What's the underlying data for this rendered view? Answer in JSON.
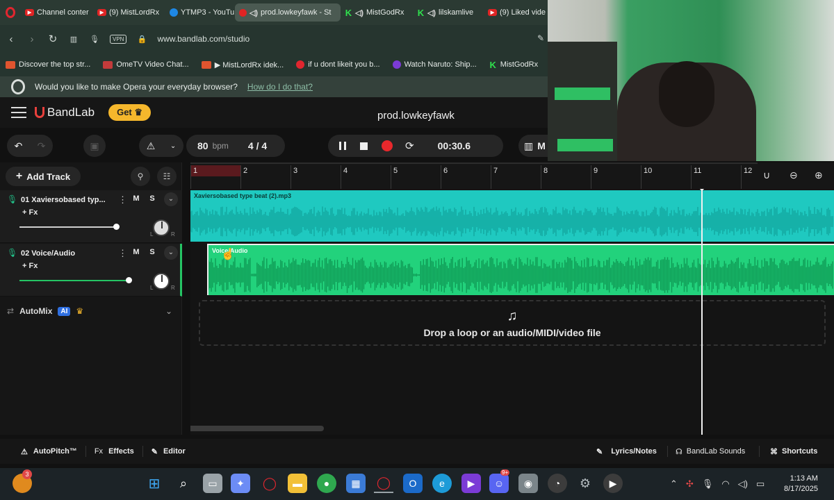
{
  "browser": {
    "tabs": [
      {
        "label": "Channel conter",
        "icon": "youtube-icon",
        "active": false
      },
      {
        "label": "(9) MistLordRx",
        "icon": "youtube-icon",
        "active": false
      },
      {
        "label": "YTMP3 - YouTu",
        "icon": "ytmp3-icon",
        "active": false
      },
      {
        "label": "prod.lowkeyfawk - St",
        "icon": "bandlab-icon",
        "active": true
      },
      {
        "label": "MistGodRx",
        "icon": "kick-icon",
        "active": false
      },
      {
        "label": "lilskamlive",
        "icon": "kick-icon",
        "active": false
      },
      {
        "label": "(9) Liked vide",
        "icon": "youtube-icon",
        "active": false
      }
    ],
    "vpn_label": "VPN",
    "url": "www.bandlab.com/studio",
    "bookmarks": [
      {
        "label": "Discover the top str...",
        "color": "#e0542f"
      },
      {
        "label": "OmeTV Video Chat...",
        "color": "#c23b3b"
      },
      {
        "label": "▶ MistLordRx idek...",
        "color": "#e0542f"
      },
      {
        "label": "if u dont likeit you b...",
        "color": "#e0262f"
      },
      {
        "label": "Watch Naruto: Ship...",
        "color": "#7b3bd6"
      },
      {
        "label": "MistGodRx",
        "color": "#2fe14d"
      }
    ],
    "opera_prompt": "Would you like to make Opera your everyday browser?",
    "opera_link": "How do I do that?"
  },
  "bandlab": {
    "logo": "BandLab",
    "get_label": "Get",
    "project_title": "prod.lowkeyfawk",
    "tempo": "80",
    "tempo_unit": "bpm",
    "time_signature": "4 / 4",
    "time_display": "00:30.6",
    "add_track_label": "Add Track",
    "tracks": [
      {
        "name": "01  Xaviersobased typ...",
        "fx": "+ Fx",
        "mute": "M",
        "solo": "S",
        "pan_l": "L",
        "pan_r": "R"
      },
      {
        "name": "02  Voice/Audio",
        "fx": "+ Fx",
        "mute": "M",
        "solo": "S",
        "pan_l": "L",
        "pan_r": "R"
      }
    ],
    "track_volumes": [
      0.71,
      0.8
    ],
    "automix_label": "AutoMix",
    "automix_badge": "AI",
    "ruler_bars": [
      "1",
      "2",
      "3",
      "4",
      "5",
      "6",
      "7",
      "8",
      "9",
      "10",
      "11",
      "12"
    ],
    "clips": [
      {
        "label": "Xaviersobased type beat (2).mp3",
        "color": "#1fc9c0"
      },
      {
        "label": "Voice/Audio",
        "color": "#22d27c"
      }
    ],
    "drop_text": "Drop a loop or an audio/MIDI/video file",
    "bottom_left": [
      {
        "icon": "autopitch-icon",
        "label": "AutoPitch™"
      },
      {
        "icon": "fx-icon",
        "label": "Effects"
      },
      {
        "icon": "pencil-icon",
        "label": "Editor"
      }
    ],
    "bottom_right": [
      {
        "icon": "pen-icon",
        "label": "Lyrics/Notes"
      },
      {
        "icon": "bandlab-icon",
        "label": "BandLab Sounds"
      },
      {
        "icon": "command-icon",
        "label": "Shortcuts"
      }
    ]
  },
  "taskbar": {
    "notification_count": "3",
    "discord_badge": "9+",
    "time": "1:13 AM",
    "date": "8/17/2025"
  },
  "colors": {
    "accent_green": "#25c464",
    "clip_teal": "#1fc9c0",
    "record_red": "#e8282c",
    "get_yellow": "#f5b72c"
  }
}
